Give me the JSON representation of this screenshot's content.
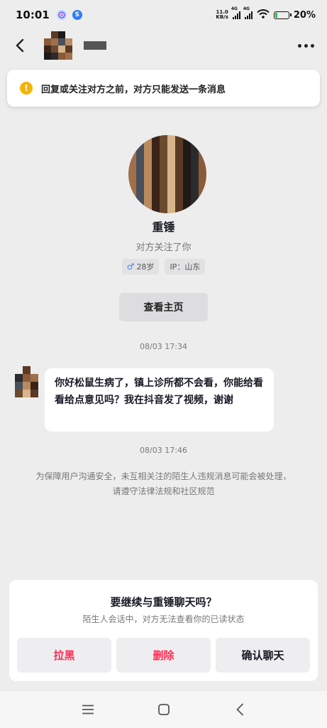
{
  "status_bar": {
    "time": "10:01",
    "net_speed_value": "11.0",
    "net_speed_unit": "KB/s",
    "network_1": "4G",
    "network_2": "4G",
    "battery": "20%",
    "battery_level": 0.2,
    "icons": [
      "app-notification-icon",
      "app-s-icon",
      "signal-icon",
      "wifi-icon",
      "battery-icon"
    ]
  },
  "header": {
    "back_icon": "chevron-left-icon",
    "more_icon": "more-dots-icon"
  },
  "notice": {
    "icon": "warning-icon",
    "text": "回复或关注对方之前，对方只能发送一条消息"
  },
  "profile": {
    "name": "重锤",
    "subtitle": "对方关注了你",
    "age_tag": "28岁",
    "ip_tag": "IP：山东",
    "view_home_label": "查看主页"
  },
  "messages": {
    "timestamp_1": "08/03 17:34",
    "bubble_text": "你好松鼠生病了，镇上诊所都不会看，你能给看看给点意见吗？我在抖音发了视频，谢谢",
    "timestamp_2": "08/03 17:46",
    "safety_note": "为保障用户沟通安全，未互相关注的陌生人违规消息可能会被处理，请遵守法律法规和社区规范"
  },
  "panel": {
    "title": "要继续与重锤聊天吗？",
    "subtitle": "陌生人会话中，对方无法查看你的已读状态",
    "block_label": "拉黑",
    "delete_label": "删除",
    "confirm_label": "确认聊天"
  },
  "colors": {
    "accent_red": "#fe2c55",
    "warning_yellow": "#f5b400",
    "background": "#ededed"
  },
  "nav": {
    "icons": [
      "menu-icon",
      "home-square-icon",
      "back-triangle-icon"
    ]
  }
}
